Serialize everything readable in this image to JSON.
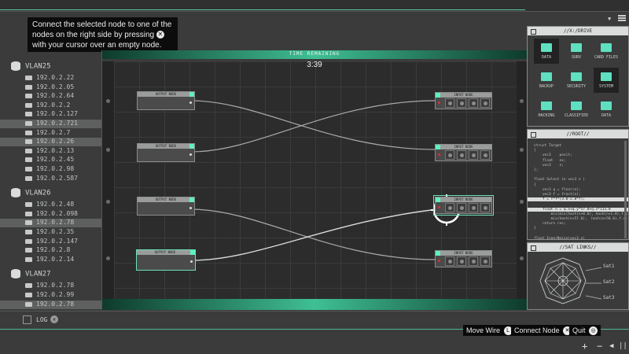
{
  "tooltip": {
    "line1": "Connect the selected node to one of the",
    "line2": "nodes on the right side by pressing",
    "line3": "with your cursor over an empty node."
  },
  "timer": {
    "label": "TIME REMAINING",
    "value": "3:39"
  },
  "vlans": [
    {
      "name": "VLAN25",
      "ips": [
        {
          "ip": "192.0.2.22",
          "sel": false
        },
        {
          "ip": "192.0.2.05",
          "sel": false
        },
        {
          "ip": "192.0.2.64",
          "sel": false
        },
        {
          "ip": "192.0.2.2",
          "sel": false
        },
        {
          "ip": "192.0.2.127",
          "sel": false
        },
        {
          "ip": "192.0.2.721",
          "sel": true
        },
        {
          "ip": "192.0.2.7",
          "sel": false
        },
        {
          "ip": "192.0.2.26",
          "sel": true
        },
        {
          "ip": "192.0.2.13",
          "sel": false
        },
        {
          "ip": "192.0.2.45",
          "sel": false
        },
        {
          "ip": "192.0.2.98",
          "sel": false
        },
        {
          "ip": "192.0.2.587",
          "sel": false
        }
      ]
    },
    {
      "name": "VLAN26",
      "ips": [
        {
          "ip": "192.0.2.48",
          "sel": false
        },
        {
          "ip": "192.0.2.098",
          "sel": false
        },
        {
          "ip": "192.0.2.78",
          "sel": true
        },
        {
          "ip": "192.0.2.35",
          "sel": false
        },
        {
          "ip": "192.0.2.147",
          "sel": false
        },
        {
          "ip": "192.0.2.8",
          "sel": false
        },
        {
          "ip": "192.0.2.14",
          "sel": false
        }
      ]
    },
    {
      "name": "VLAN27",
      "ips": [
        {
          "ip": "192.0.2.78",
          "sel": false
        },
        {
          "ip": "192.0.2.99",
          "sel": false
        },
        {
          "ip": "192.0.2.78",
          "sel": true
        }
      ]
    }
  ],
  "nodes": {
    "output_label": "OUTPUT NODE",
    "input_label": "INPUT NODE"
  },
  "drive": {
    "title": "//X:/DRIVE",
    "folders": [
      "DATA",
      "SURV",
      "CARD FILES",
      "BACKUP",
      "SECURITY",
      "SYSTEM",
      "HACKING",
      "CLASSIFIED",
      "DATA"
    ]
  },
  "root": {
    "title": "//ROOT//",
    "lines": [
      "struct Target",
      "{",
      "    vec3    posit;",
      "    float   ex;",
      "    vec3    n;",
      "};",
      "",
      "float Select in vec3 n )",
      "{",
      "    vec3 q = floor(n);",
      "    vec3 f = fract(n);",
      "    f = f*f*(3.0-2.0*f);",
      "",
      "    float n = q.x+q.y*57.0+q.z*113.0",
      "        mix(mix(hash(n+0.0), hash(n+1.0),f.x),",
      "        mix(hash(n+57.0),  hash(n+58.0),f.x),f.y);",
      "    return res;",
      "}",
      "",
      "float InnerNoise(vec3 n)"
    ],
    "highlight": [
      11,
      13
    ]
  },
  "sat": {
    "title": "//SAT LINKS//",
    "links": [
      "Sat1",
      "Sat2",
      "Sat3"
    ]
  },
  "log": {
    "label": "LOG"
  },
  "hints": [
    {
      "label": "Move Wire",
      "glyph": "L"
    },
    {
      "label": "Connect Node",
      "glyph": "✕"
    },
    {
      "label": "Quit",
      "glyph": "◎"
    }
  ],
  "controls": {
    "plus": "+",
    "minus": "−",
    "back": "◀",
    "pause": "|||"
  }
}
